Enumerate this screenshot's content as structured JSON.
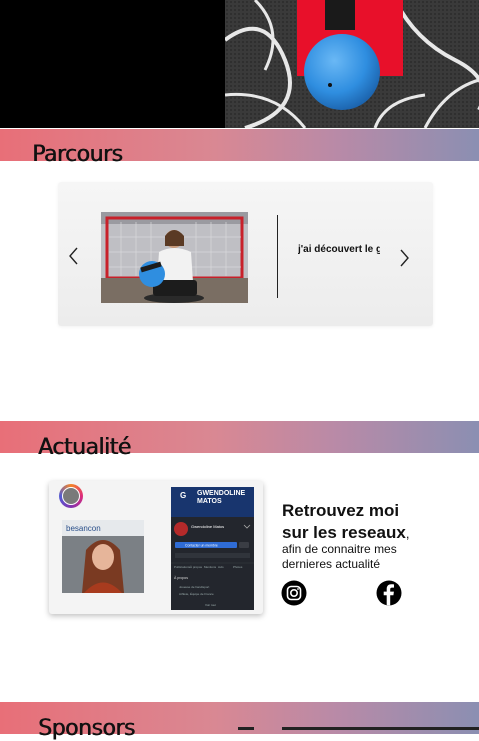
{
  "sections": {
    "parcours_title": "Parcours",
    "actualite_title": "Actualité",
    "sponsors_title": "Sponsors"
  },
  "carousel": {
    "slide_text": "j'ai découvert le g"
  },
  "social": {
    "heading_line1": "Retrouvez moi",
    "heading_line2": "sur les reseaux",
    "heading_suffix": ",",
    "subtext": "afin de connaitre mes dernieres actualité",
    "fb_card": {
      "banner": "GWENDOLINE MATOS",
      "profile_name": "Gwendoline Matos",
      "button": "Contacter un membre",
      "tabs": [
        "Publications",
        "À propos",
        "Mentions",
        "Avis",
        "Photos"
      ],
      "rows": [
        "À propos",
        "Joueuse de handisport",
        "Athlète, Équipe de France"
      ],
      "footer": "Voir tout"
    },
    "portrait_caption": "besancon"
  },
  "colors": {
    "band_start": "#e86f78",
    "band_end": "#8b8fb2",
    "ball_blue": "#2f8ee0",
    "red_panel": "#e8102a"
  }
}
